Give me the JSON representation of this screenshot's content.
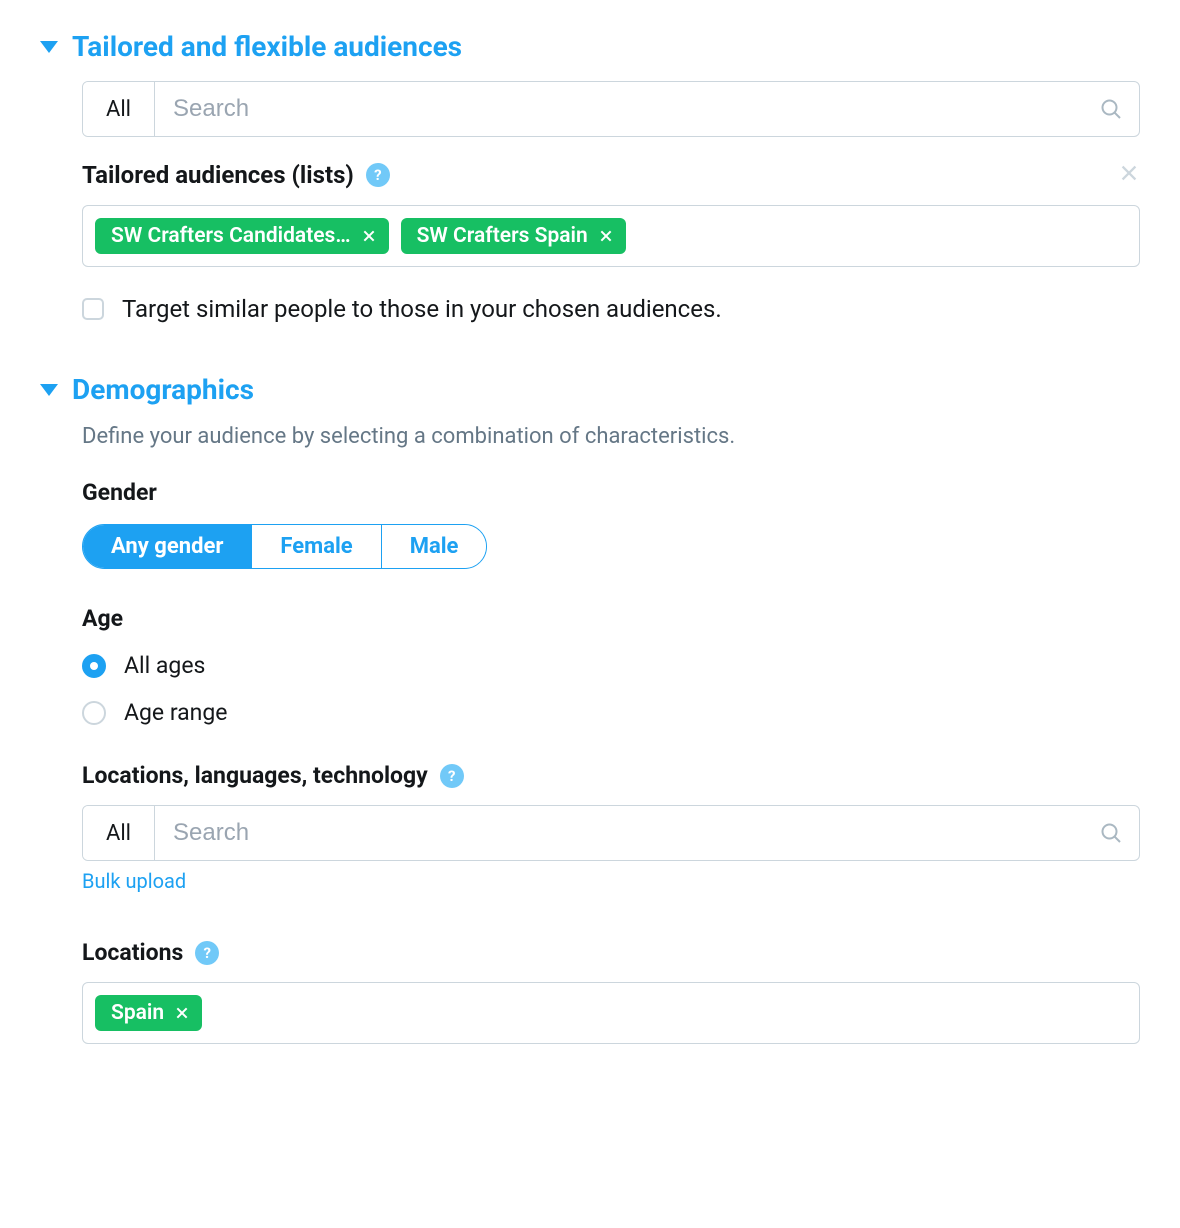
{
  "sections": {
    "audiences": {
      "title": "Tailored and flexible audiences",
      "search_filter": "All",
      "search_placeholder": "Search",
      "tailored_label": "Tailored audiences (lists)",
      "chips": [
        "SW Crafters Candidates…",
        "SW Crafters Spain"
      ],
      "similar_checkbox_label": "Target similar people to those in your chosen audiences."
    },
    "demographics": {
      "title": "Demographics",
      "subtitle": "Define your audience by selecting a combination of characteristics.",
      "gender": {
        "label": "Gender",
        "options": [
          "Any gender",
          "Female",
          "Male"
        ],
        "selected": "Any gender"
      },
      "age": {
        "label": "Age",
        "options": [
          "All ages",
          "Age range"
        ],
        "selected": "All ages"
      },
      "llt": {
        "label": "Locations, languages, technology",
        "search_filter": "All",
        "search_placeholder": "Search",
        "bulk_upload": "Bulk upload"
      },
      "locations": {
        "label": "Locations",
        "chips": [
          "Spain"
        ]
      }
    }
  }
}
